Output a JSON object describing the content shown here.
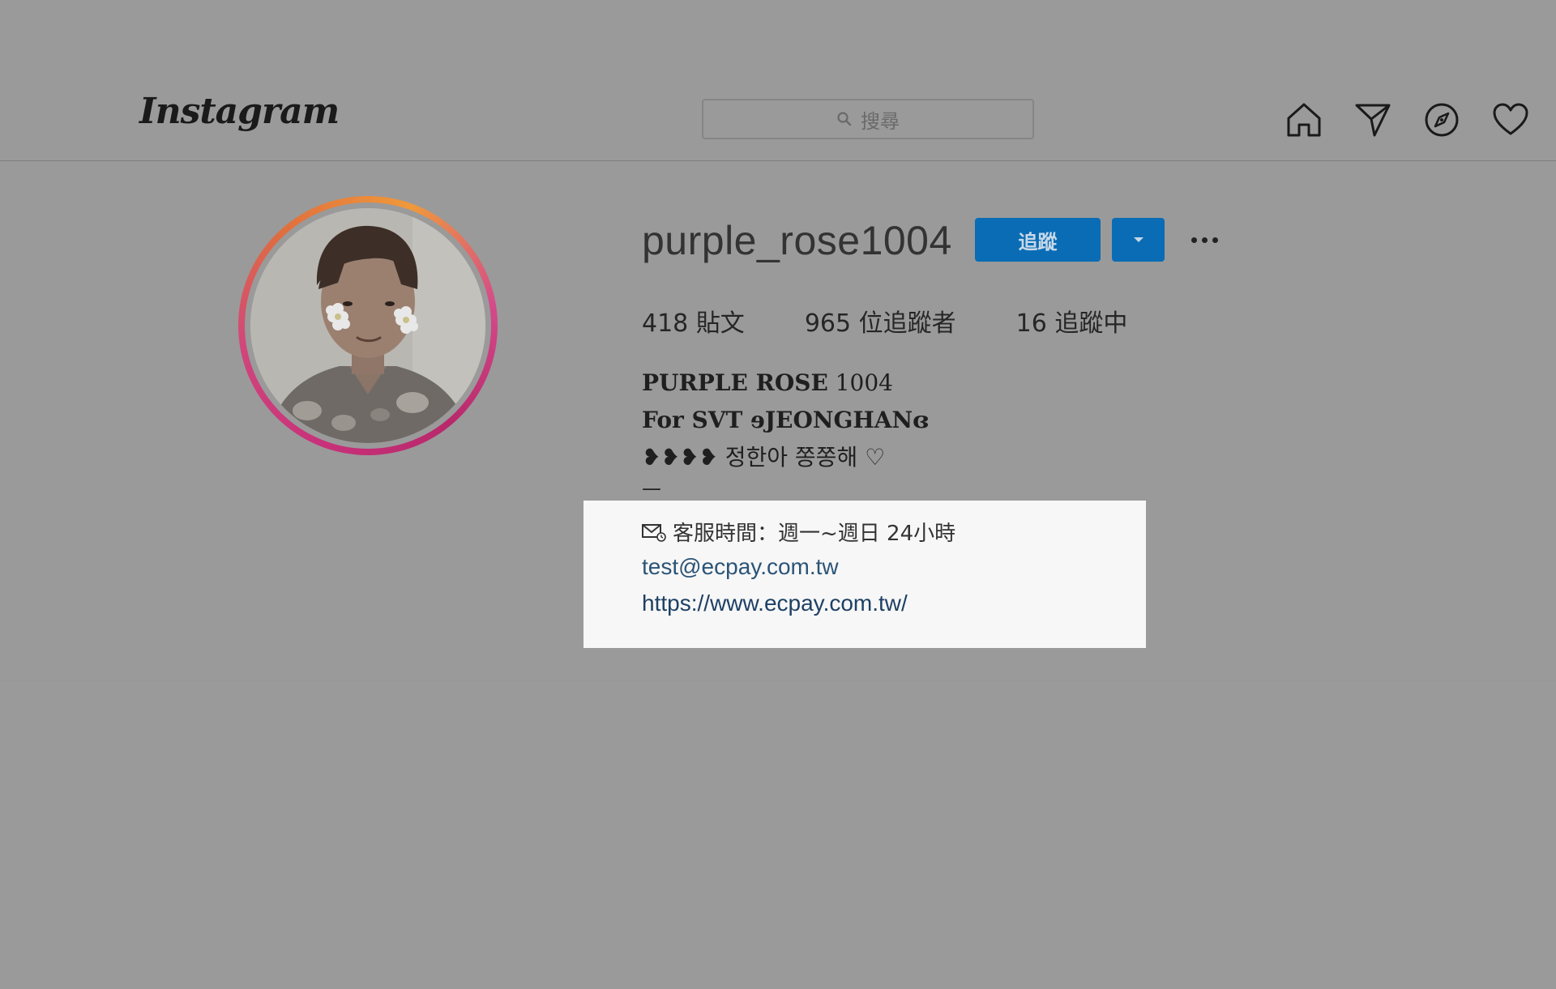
{
  "header": {
    "logo_text": "Instagram",
    "search_placeholder": "搜尋",
    "icons": [
      "home-icon",
      "direct-message-icon",
      "explore-compass-icon",
      "activity-heart-icon"
    ]
  },
  "profile": {
    "username": "purple_rose1004",
    "follow_label": "追蹤",
    "stats": {
      "posts_count": "418",
      "posts_label": "貼文",
      "followers_count": "965",
      "followers_label": "位追蹤者",
      "following_count": "16",
      "following_label": "追蹤中"
    },
    "bio": {
      "name_bold": "PURPLE ROSE",
      "name_number": " 1004",
      "line2": "For SVT ɘJEONGHANɞ",
      "line3_hearts": "❥❥❥❥",
      "line3_text": " 정한아 쫑쫑해 ♡",
      "line4": "—"
    },
    "contact": {
      "service_hours": "客服時間：週一~週日 24小時",
      "email": "test@ecpay.com.tw",
      "website": "https://www.ecpay.com.tw/"
    }
  },
  "colors": {
    "overlay_bg": "#9a9a9a",
    "follow_blue": "#0a6cb5",
    "highlight_bg": "#f7f7f7",
    "link_color": "#1e4064"
  }
}
